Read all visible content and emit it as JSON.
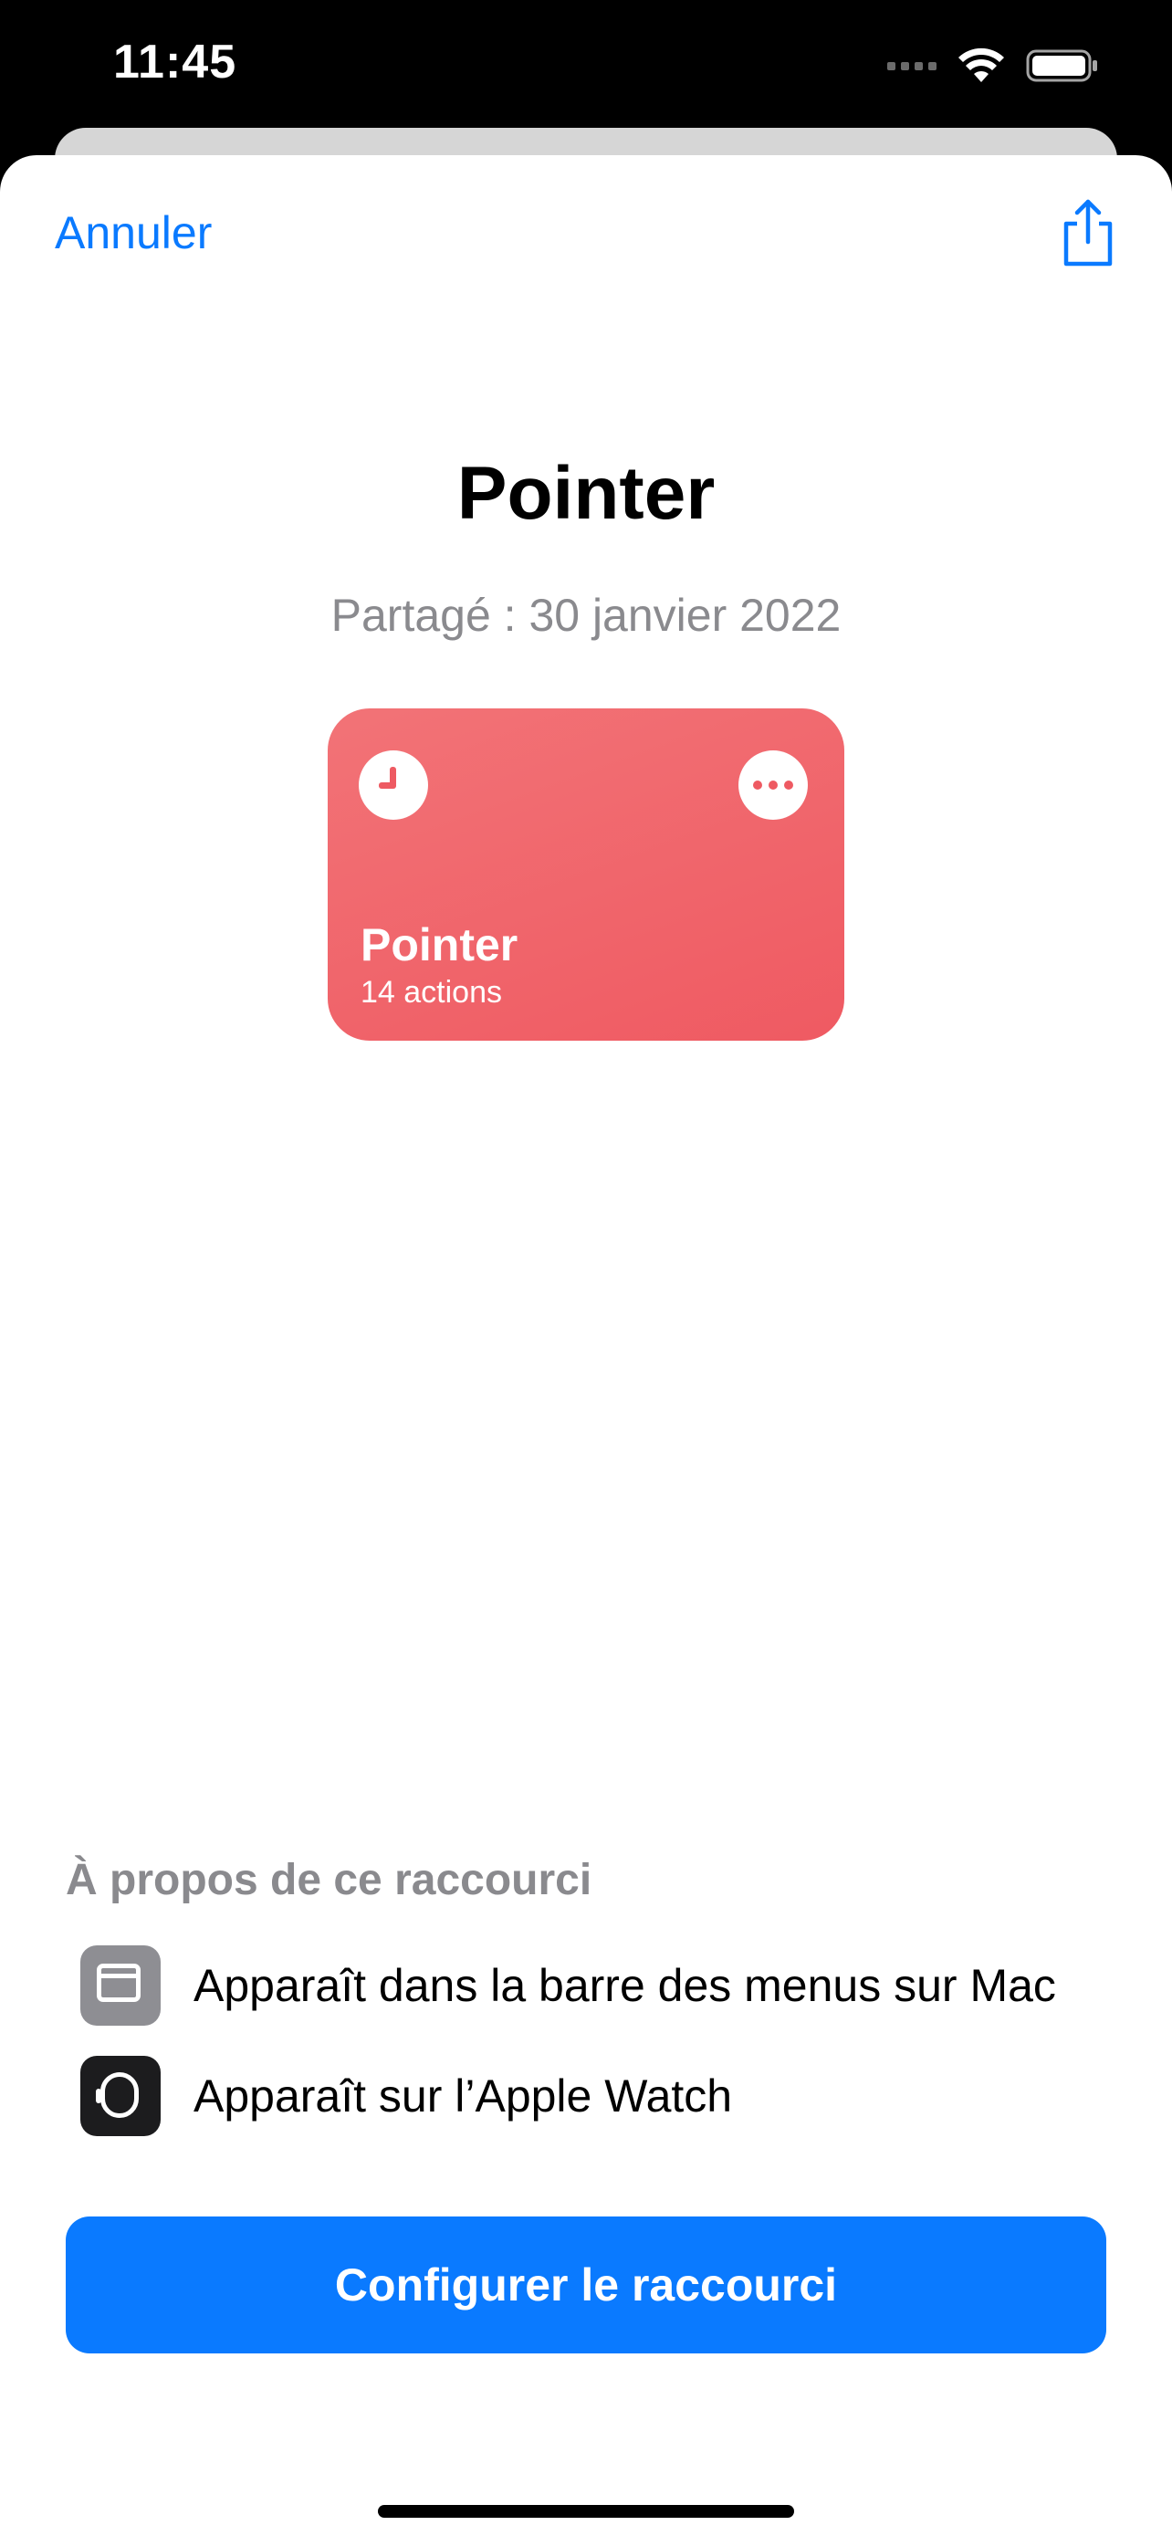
{
  "status_bar": {
    "time": "11:45"
  },
  "nav": {
    "cancel_label": "Annuler",
    "share_icon": "share-icon"
  },
  "shortcut": {
    "title": "Pointer",
    "shared_date": "Partagé : 30 janvier 2022",
    "card": {
      "name": "Pointer",
      "actions_count": "14 actions",
      "color": "#F0646A",
      "glyph": "clock-icon"
    }
  },
  "about": {
    "heading": "À propos de ce raccourci",
    "items": [
      {
        "icon": "menu-bar-icon",
        "label": "Apparaît dans la barre des menus sur Mac"
      },
      {
        "icon": "apple-watch-icon",
        "label": "Apparaît sur l’Apple Watch"
      }
    ]
  },
  "primary_action": {
    "label": "Configurer le raccourci"
  },
  "colors": {
    "accent": "#0A7AFF",
    "secondary_text": "#8A8A8E"
  }
}
